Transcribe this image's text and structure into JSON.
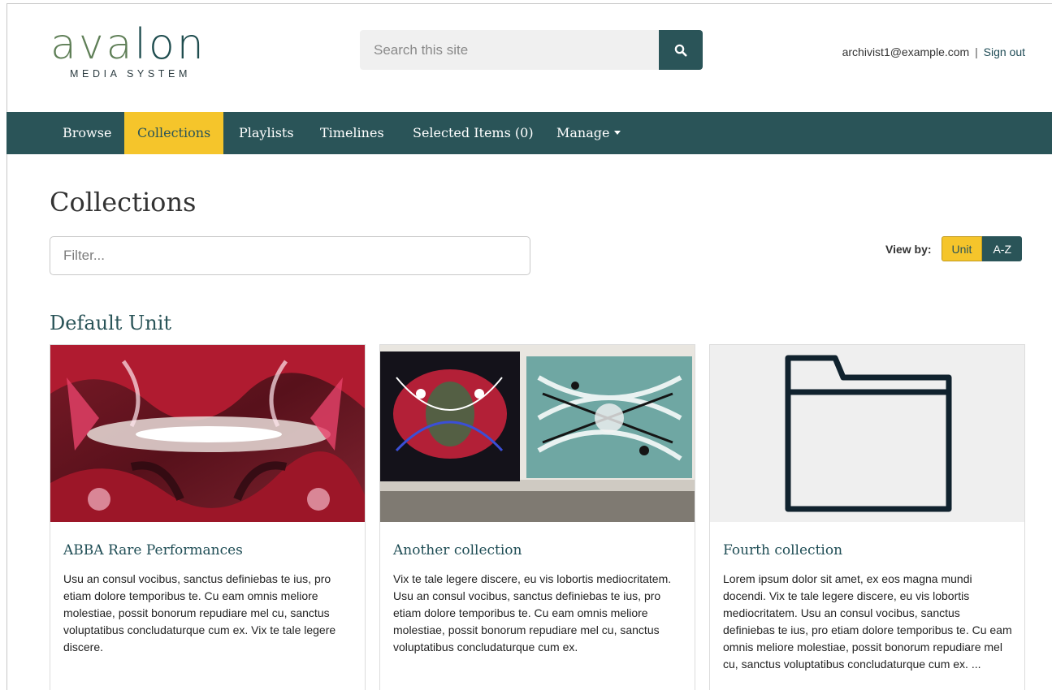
{
  "header": {
    "logo_word_a": "ava",
    "logo_word_b": "lon",
    "logo_sub": "MEDIA SYSTEM",
    "search_placeholder": "Search this site",
    "search_icon": "search-icon",
    "user_email": "archivist1@example.com",
    "separator": "|",
    "sign_out": "Sign out"
  },
  "nav": {
    "items": [
      {
        "label": "Browse"
      },
      {
        "label": "Collections",
        "active": true
      },
      {
        "label": "Playlists"
      },
      {
        "label": "Timelines"
      },
      {
        "label": "Selected Items (0)"
      },
      {
        "label": "Manage",
        "dropdown": true
      }
    ]
  },
  "page": {
    "title": "Collections",
    "filter_placeholder": "Filter...",
    "view_by_label": "View by:",
    "view_by_options": [
      "Unit",
      "A-Z"
    ],
    "view_by_selected": "Unit",
    "unit_heading": "Default Unit"
  },
  "collections": [
    {
      "title": "ABBA Rare Performances",
      "description": "Usu an consul vocibus, sanctus definiebas te ius, pro etiam dolore temporibus te. Cu eam omnis meliore molestiae, possit bonorum repudiare mel cu, sanctus voluptatibus concludaturque cum ex. Vix te tale legere discere.",
      "image": "red-black-abstract-painting"
    },
    {
      "title": "Another collection",
      "description": "Vix te tale legere discere, eu vis lobortis mediocritatem. Usu an consul vocibus, sanctus definiebas te ius, pro etiam dolore temporibus te. Cu eam omnis meliore molestiae, possit bonorum repudiare mel cu, sanctus voluptatibus concludaturque cum ex.",
      "image": "two-abstract-paintings"
    },
    {
      "title": "Fourth collection",
      "description": "Lorem ipsum dolor sit amet, ex eos magna mundi docendi. Vix te tale legere discere, eu vis lobortis mediocritatem. Usu an consul vocibus, sanctus definiebas te ius, pro etiam dolore temporibus te. Cu eam omnis meliore molestiae, possit bonorum repudiare mel cu, sanctus voluptatibus concludaturque cum ex. ...",
      "image": "folder-icon"
    }
  ],
  "colors": {
    "brand_teal": "#2a5458",
    "accent_yellow": "#f5c52b",
    "logo_green": "#5f7f57"
  }
}
